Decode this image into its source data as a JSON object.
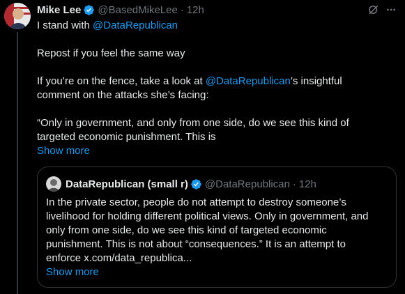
{
  "post": {
    "author_name": "Mike Lee",
    "author_handle": "@BasedMikeLee",
    "separator": "·",
    "time": "12h",
    "line1_prefix": "I stand with ",
    "line1_mention": "@DataRepublican",
    "line2": "Repost if you feel the same way",
    "line3_prefix": "If you’re on the fence, take a look at ",
    "line3_mention": "@DataRepublican",
    "line3_suffix": "’s insightful",
    "line4": "comment on the attacks she’s facing:",
    "line5": "“Only in government, and only from one side, do we see this kind of",
    "line6": "targeted economic punishment. This is",
    "show_more": "Show more"
  },
  "quote": {
    "author_name": "DataRepublican (small r)",
    "author_handle": "@DataRepublican",
    "separator": "·",
    "time": "12h",
    "lines": [
      "In the private sector, people do not attempt to destroy someone’s",
      "livelihood for holding different political views. Only in government, and",
      "only from one side, do we see this kind of targeted economic",
      "punishment. This is not about “consequences.” It is an attempt to",
      "enforce x.com/data_republica..."
    ],
    "show_more": "Show more"
  },
  "colors": {
    "background": "#000000",
    "text": "#e7e9ea",
    "muted": "#71767b",
    "link": "#1d9bf0",
    "border": "#2f3336"
  },
  "icons": [
    "verified-badge-icon",
    "grok-icon",
    "more-options-icon"
  ]
}
